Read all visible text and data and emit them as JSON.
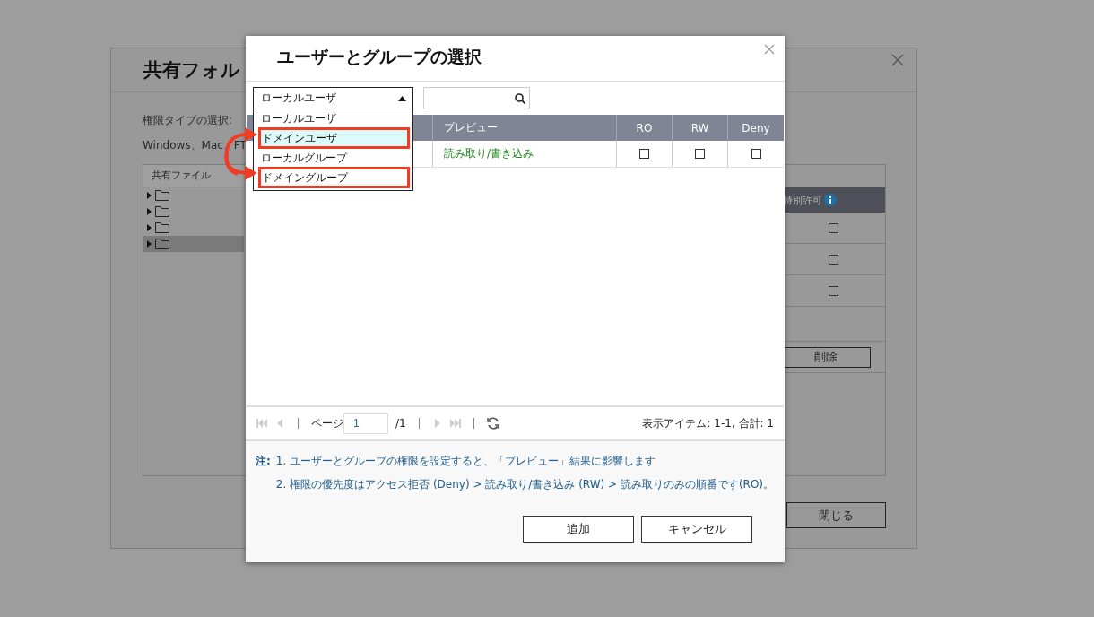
{
  "background_dialog": {
    "title": "共有フォル",
    "permission_type_label": "権限タイプの選択:",
    "description": "Windows、Mac、FT",
    "tree": {
      "header": "共有ファイル",
      "items": [
        {
          "selected": false
        },
        {
          "selected": false
        },
        {
          "selected": false
        },
        {
          "selected": true
        }
      ]
    },
    "special_column": {
      "header": "特別許可",
      "checkboxes": [
        {
          "checked": false
        },
        {
          "checked": false
        },
        {
          "checked": false
        }
      ]
    },
    "delete_button": "削除",
    "close_button": "閉じる"
  },
  "dialog": {
    "title": "ユーザーとグループの選択",
    "account_type": {
      "value": "ローカルユーザ",
      "expanded": true,
      "options": [
        {
          "label": "ローカルユーザ",
          "highlighted": false,
          "annotated": false
        },
        {
          "label": "ドメインユーザ",
          "highlighted": true,
          "annotated": true
        },
        {
          "label": "ローカルグループ",
          "highlighted": false,
          "annotated": false
        },
        {
          "label": "ドメイングループ",
          "highlighted": false,
          "annotated": true
        }
      ]
    },
    "table": {
      "columns": [
        "プレビュー",
        "RO",
        "RW",
        "Deny"
      ],
      "rows": [
        {
          "preview": "読み取り/書き込み",
          "ro": false,
          "rw": false,
          "deny": false
        }
      ]
    },
    "pager": {
      "page_label": "ページ",
      "page_value": "1",
      "page_total": "/1",
      "summary": "表示アイテム: 1-1, 合計: 1"
    },
    "notes": {
      "label": "注:",
      "lines": [
        "1. ユーザーとグループの権限を設定すると、「プレビュー」結果に影響します",
        "2. 権限の優先度はアクセス拒否 (Deny) > 読み取り/書き込み (RW) > 読み取りのみの順番です(RO)。"
      ]
    },
    "buttons": [
      "追加",
      "キャンセル"
    ]
  }
}
